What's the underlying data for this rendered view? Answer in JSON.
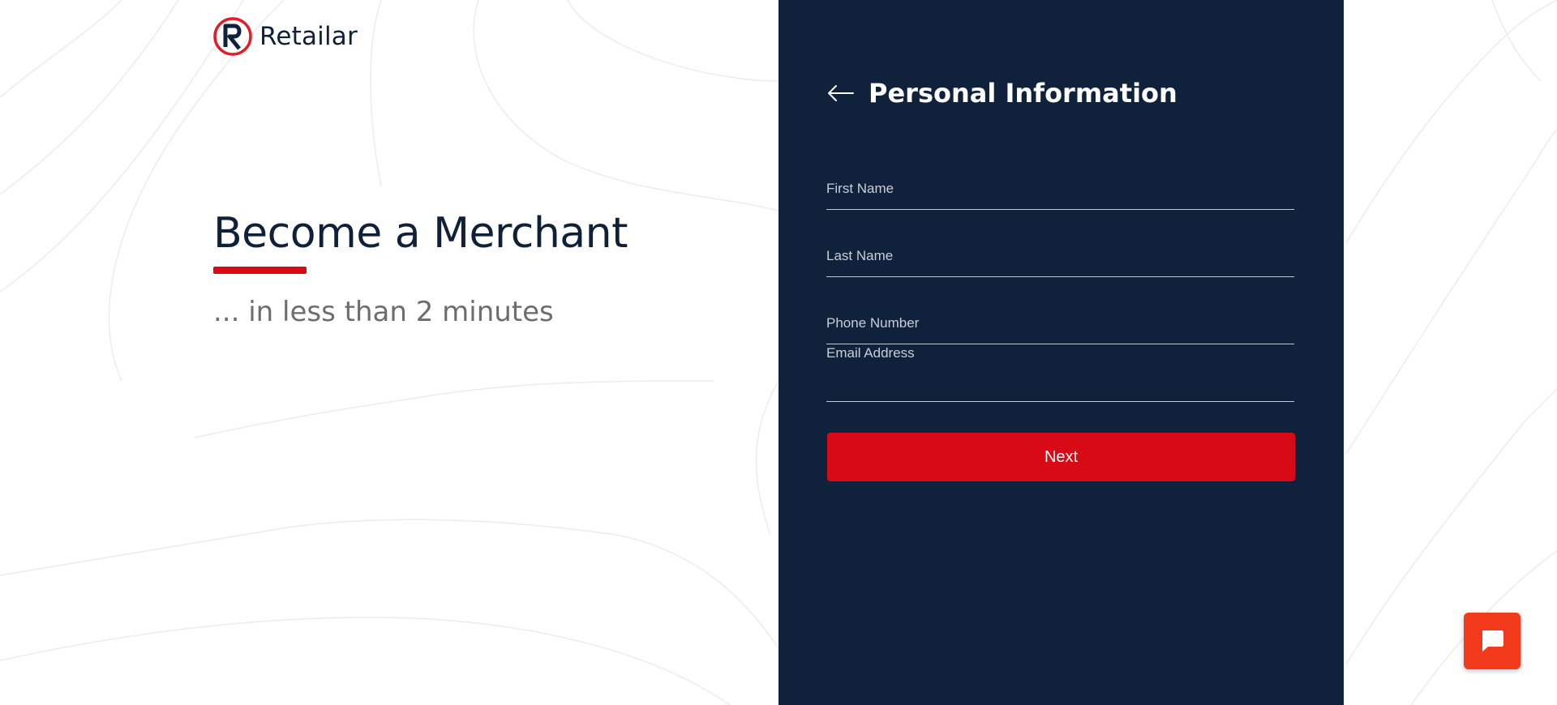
{
  "brand": {
    "name": "Retailar",
    "logo_icon": "retailar-logo-icon",
    "primary_color": "#0f213b",
    "accent_color": "#d80a16"
  },
  "hero": {
    "title": "Become a Merchant",
    "subtitle": "... in less than 2 minutes"
  },
  "form": {
    "title": "Personal Information",
    "back_icon": "arrow-left-icon",
    "fields": {
      "first_name": {
        "label": "First Name",
        "value": ""
      },
      "last_name": {
        "label": "Last Name",
        "value": ""
      },
      "phone_number": {
        "label": "Phone Number",
        "value": ""
      },
      "email_address": {
        "label": "Email Address",
        "value": ""
      }
    },
    "next_label": "Next"
  },
  "chat_widget": {
    "icon": "chat-bubble-icon",
    "color": "#f23b1d"
  }
}
